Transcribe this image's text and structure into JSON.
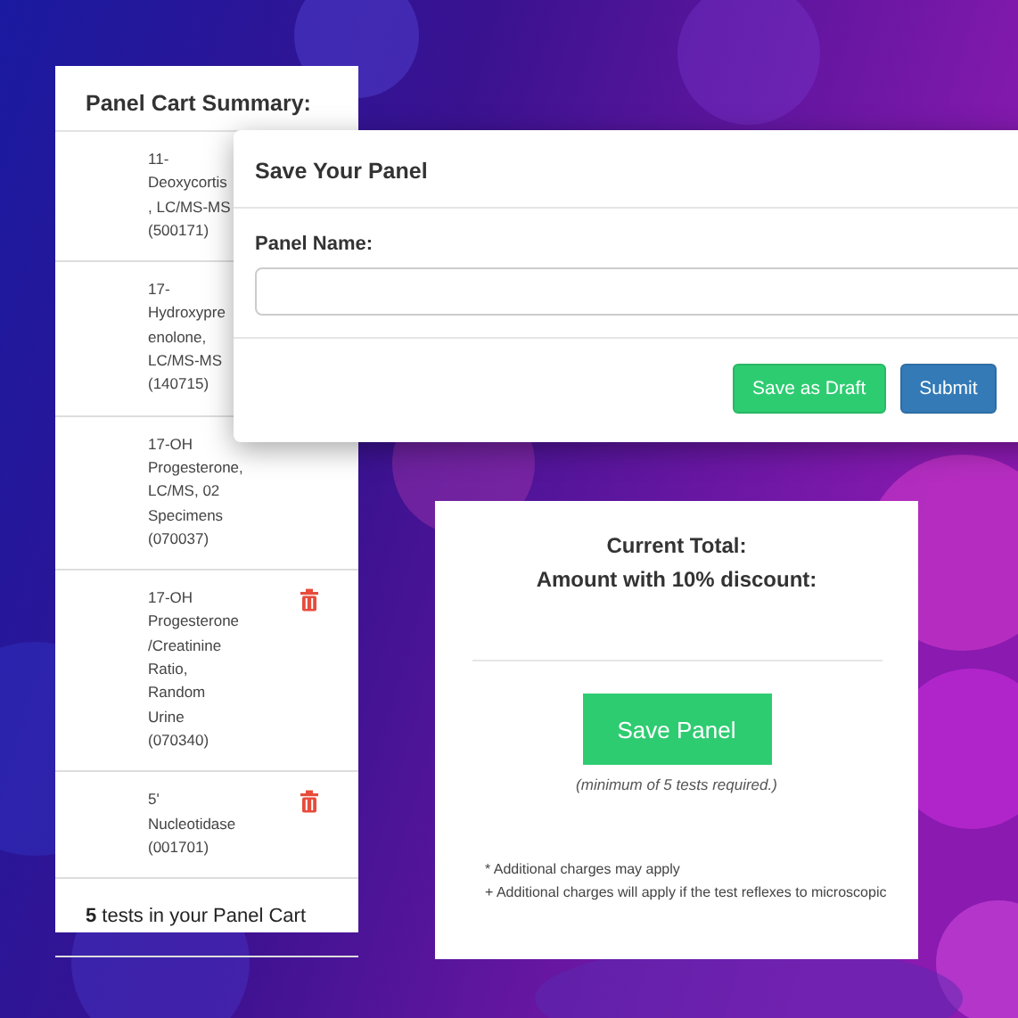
{
  "cart": {
    "title": "Panel Cart Summary:",
    "items": [
      {
        "lines": [
          "11-",
          "Deoxycortis",
          ", LC/MS-MS",
          "(500171)"
        ]
      },
      {
        "lines": [
          "17-",
          "Hydroxypre",
          "enolone,",
          "LC/MS-MS",
          "(140715)"
        ]
      },
      {
        "lines": [
          "17-OH",
          "Progesterone,",
          "LC/MS, 02",
          "Specimens",
          "(070037)"
        ]
      },
      {
        "lines": [
          "17-OH",
          "Progesterone",
          "/Creatinine",
          "Ratio,",
          "Random",
          "Urine",
          "(070340)"
        ],
        "delete_icon": true
      },
      {
        "lines": [
          "5'",
          "Nucleotidase",
          "(001701)"
        ],
        "delete_icon": true
      }
    ],
    "footer": "**5** tests in your Panel Cart"
  },
  "modal": {
    "title": "Save Your Panel",
    "field_label": "Panel Name:",
    "buttons": [
      {
        "label": "Save as Draft",
        "kind": "success"
      },
      {
        "label": "Submit",
        "kind": "primary"
      }
    ]
  },
  "totals": {
    "lines": [
      "Current Total:",
      "Amount with 10% discount:"
    ],
    "button": "Save Panel",
    "caption": "(minimum of 5 tests required.)",
    "notes": [
      "* Additional charges may apply",
      "+ Additional charges will apply if the test reflexes to microscopic"
    ]
  }
}
